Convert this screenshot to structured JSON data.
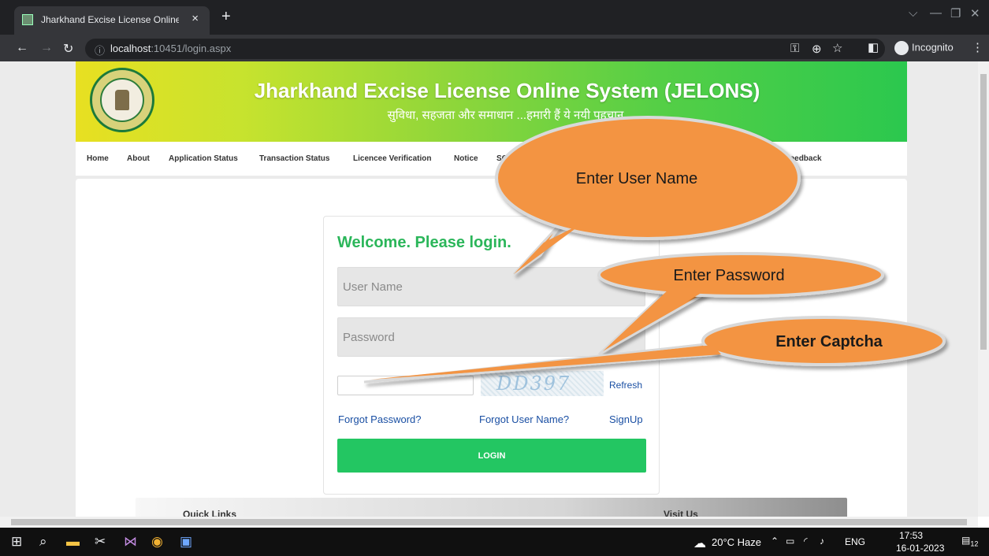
{
  "browser": {
    "tab_title": "Jharkhand Excise License Online S",
    "tab_close": "×",
    "new_tab": "+",
    "url_host": "localhost",
    "url_rest": ":10451/login.aspx",
    "incognito_label": "Incognito"
  },
  "site": {
    "title": "Jharkhand Excise License Online System (JELONS)",
    "tagline": "सुविधा, सहजता और समाधान ...हमारी हैं ये नयी पहचान"
  },
  "nav": {
    "items": [
      "Home",
      "About",
      "Application Status",
      "Transaction Status",
      "Licencee Verification",
      "Notice",
      "SOP",
      "licy Feedback"
    ]
  },
  "login": {
    "welcome": "Welcome. Please login.",
    "username_placeholder": "User Name",
    "password_placeholder": "Password",
    "captcha_text": "DD397",
    "refresh": "Refresh",
    "forgot_password": "Forgot Password?",
    "forgot_username": "Forgot User Name?",
    "signup": "SignUp",
    "login_button": "LOGIN"
  },
  "footer": {
    "quick_links": "Quick Links",
    "visit_us": "Visit Us"
  },
  "callouts": {
    "username": "Enter User Name",
    "password": "Enter Password",
    "captcha": "Enter Captcha",
    "fill_color": "#f39443",
    "border_color": "#d9d9d9"
  },
  "taskbar": {
    "weather": "20°C  Haze",
    "lang": "ENG",
    "time": "17:53",
    "date": "16-01-2023",
    "notifications": "12"
  }
}
